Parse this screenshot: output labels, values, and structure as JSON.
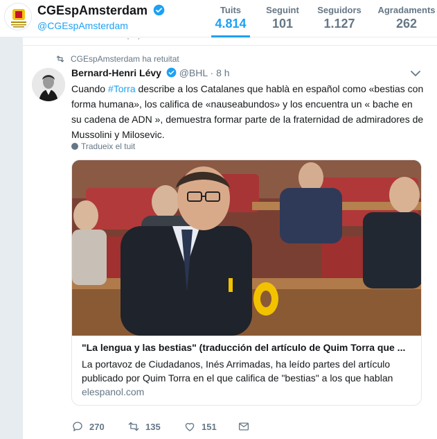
{
  "profile": {
    "name": "CGEspAmsterdam",
    "handle": "@CGEspAmsterdam",
    "stats": [
      {
        "label": "Tuits",
        "value": "4.814"
      },
      {
        "label": "Seguint",
        "value": "101"
      },
      {
        "label": "Seguidors",
        "value": "1.127"
      },
      {
        "label": "Agradaments",
        "value": "262"
      }
    ]
  },
  "tweet": {
    "retweet_context": "CGEspAmsterdam ha retuitat",
    "author_name": "Bernard-Henri Lévy",
    "author_handle": "@BHL",
    "separator": " · ",
    "time": "8 h",
    "text_before": "Cuando ",
    "hashtag": "#Torra",
    "text_after": " describe a los Catalanes que hablà en español como «bestias con forma humana», los califica de «nauseabundos» y los encuentra un « bache en su cadena de ADN », demuestra formar parte de la fraternidad de admiradores de Mussolini y Milosevic.",
    "translate_label": "Tradueix el tuit",
    "card": {
      "title": "\"La lengua y las bestias\" (traducción del artículo de Quim Torra que ...",
      "description": "La portavoz de Ciudadanos, Inés Arrimadas, ha leído partes del artículo publicado por Quim Torra en el que califica de \"bestias\" a los que hablan",
      "domain": "elespanol.com"
    },
    "actions": {
      "replies": "270",
      "retweets": "135",
      "likes": "151"
    }
  },
  "colors": {
    "accent": "#1da1f2",
    "muted": "#657786",
    "background": "#e6ecf0"
  },
  "icons": [
    "verified-badge-icon",
    "retweet-icon",
    "caret-down-icon",
    "globe-icon",
    "reply-icon",
    "like-icon",
    "message-icon"
  ]
}
